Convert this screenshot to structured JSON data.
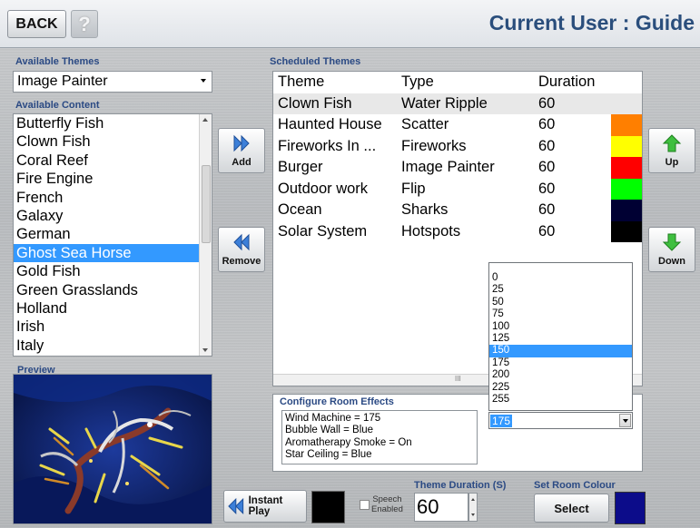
{
  "header": {
    "back_label": "BACK",
    "help_icon": "?",
    "user_title": "Current User : Guide"
  },
  "available_themes": {
    "label": "Available Themes",
    "selected": "Image Painter"
  },
  "available_content": {
    "label": "Available Content",
    "items": [
      "Butterfly Fish",
      "Clown Fish",
      "Coral Reef",
      "Fire Engine",
      "French",
      "Galaxy",
      "German",
      "Ghost Sea Horse",
      "Gold Fish",
      "Green Grasslands",
      "Holland",
      "Irish",
      "Italy"
    ],
    "selected_index": 7
  },
  "preview": {
    "label": "Preview"
  },
  "buttons": {
    "add": "Add",
    "remove": "Remove",
    "up": "Up",
    "down": "Down",
    "instant_play": "Instant Play",
    "select": "Select"
  },
  "scheduled_themes": {
    "label": "Scheduled Themes",
    "columns": [
      "Theme",
      "Type",
      "Duration"
    ],
    "rows": [
      {
        "theme": "Clown Fish",
        "type": "Water Ripple",
        "duration": "60",
        "color": ""
      },
      {
        "theme": "Haunted House",
        "type": "Scatter",
        "duration": "60",
        "color": "#ff7f00"
      },
      {
        "theme": "Fireworks In ...",
        "type": "Fireworks",
        "duration": "60",
        "color": "#ffff00"
      },
      {
        "theme": "Burger",
        "type": "Image Painter",
        "duration": "60",
        "color": "#ff0000"
      },
      {
        "theme": "Outdoor work",
        "type": "Flip",
        "duration": "60",
        "color": "#00ff00"
      },
      {
        "theme": "Ocean",
        "type": "Sharks",
        "duration": "60",
        "color": "#000033"
      },
      {
        "theme": "Solar System",
        "type": "Hotspots",
        "duration": "60",
        "color": "#000000"
      }
    ],
    "scroll_glyph": "III"
  },
  "duration_dropdown": {
    "options": [
      "0",
      "25",
      "50",
      "75",
      "100",
      "125",
      "150",
      "175",
      "200",
      "225",
      "255"
    ],
    "highlighted_index": 6,
    "selected_value": "175"
  },
  "room_effects": {
    "label": "Configure Room Effects",
    "lines": [
      "Wind Machine = 175",
      "Bubble Wall = Blue",
      "Aromatherapy Smoke = On",
      "Star Ceiling = Blue"
    ]
  },
  "bottom": {
    "speech_label_1": "Speech",
    "speech_label_2": "Enabled",
    "theme_duration_label": "Theme Duration (S)",
    "theme_duration_value": "60",
    "set_room_colour_label": "Set Room Colour"
  },
  "colors": {
    "accent": "#2b4a84",
    "selection": "#3399ff",
    "arrow_green": "#3fbf3f",
    "arrow_blue": "#3c7fd8",
    "room_colour": "#0c0c8a"
  }
}
